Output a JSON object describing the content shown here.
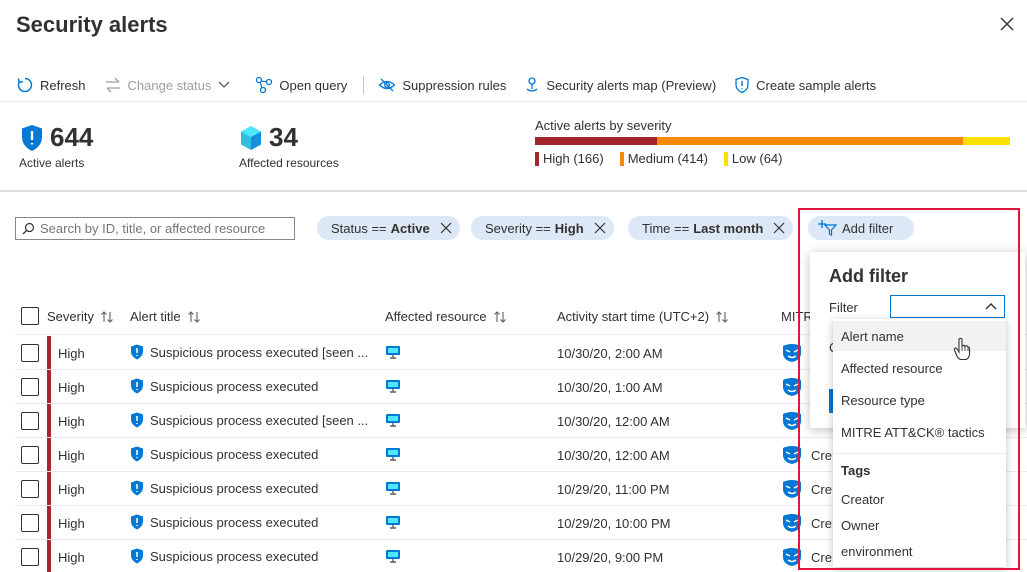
{
  "page": {
    "title": "Security alerts"
  },
  "toolbar": {
    "refresh": "Refresh",
    "change_status": "Change status",
    "open_query": "Open query",
    "suppression_rules": "Suppression rules",
    "alerts_map": "Security alerts map (Preview)",
    "sample_alerts": "Create sample alerts"
  },
  "metrics": {
    "active_alerts": {
      "value": "644",
      "label": "Active alerts"
    },
    "affected_resources": {
      "value": "34",
      "label": "Affected resources"
    }
  },
  "severity": {
    "title": "Active alerts by severity",
    "high": {
      "label": "High (166)",
      "count": 166,
      "color": "#a4262c"
    },
    "medium": {
      "label": "Medium (414)",
      "count": 414,
      "color": "#f7890a"
    },
    "low": {
      "label": "Low (64)",
      "count": 64,
      "color": "#fce100"
    }
  },
  "filters": {
    "search_placeholder": "Search by ID, title, or affected resource",
    "pills": [
      {
        "key": "Status ==",
        "value": "Active"
      },
      {
        "key": "Severity ==",
        "value": "High"
      },
      {
        "key": "Time ==",
        "value": "Last month"
      }
    ],
    "add_filter": "Add filter"
  },
  "table": {
    "columns": {
      "severity": "Severity",
      "alert_title": "Alert title",
      "affected_resource": "Affected resource",
      "activity_start": "Activity start time (UTC+2)",
      "mitre": "MITRE"
    },
    "rows": [
      {
        "severity": "High",
        "title": "Suspicious process executed [seen ...",
        "time": "10/30/20, 2:00 AM",
        "extra": ""
      },
      {
        "severity": "High",
        "title": "Suspicious process executed",
        "time": "10/30/20, 1:00 AM",
        "extra": ""
      },
      {
        "severity": "High",
        "title": "Suspicious process executed [seen ...",
        "time": "10/30/20, 12:00 AM",
        "extra": ""
      },
      {
        "severity": "High",
        "title": "Suspicious process executed",
        "time": "10/30/20, 12:00 AM",
        "extra": "Cre"
      },
      {
        "severity": "High",
        "title": "Suspicious process executed",
        "time": "10/29/20, 11:00 PM",
        "extra": "Cre"
      },
      {
        "severity": "High",
        "title": "Suspicious process executed",
        "time": "10/29/20, 10:00 PM",
        "extra": "Cre"
      },
      {
        "severity": "High",
        "title": "Suspicious process executed",
        "time": "10/29/20, 9:00 PM",
        "extra": "Cre"
      }
    ]
  },
  "add_filter_panel": {
    "title": "Add filter",
    "filter_label": "Filter",
    "partial_label": "C",
    "options": [
      "Alert name",
      "Affected resource",
      "Resource type",
      "MITRE ATT&CK® tactics"
    ],
    "tags_header": "Tags",
    "tag_options": [
      "Creator",
      "Owner",
      "environment"
    ]
  }
}
